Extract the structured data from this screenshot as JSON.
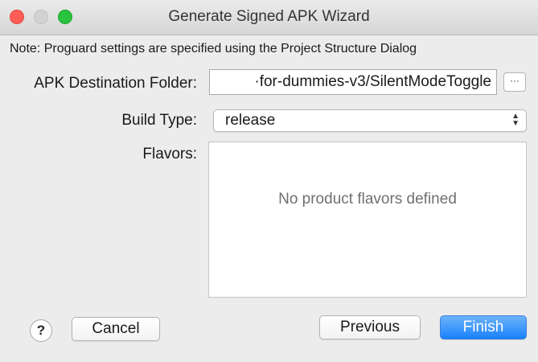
{
  "window": {
    "title": "Generate Signed APK Wizard"
  },
  "note": "Note: Proguard settings are specified using the Project Structure Dialog",
  "fields": {
    "apk_destination": {
      "label": "APK Destination Folder:",
      "value": "·for-dummies-v3/SilentModeToggle",
      "browse_label": "···"
    },
    "build_type": {
      "label": "Build Type:",
      "value": "release"
    },
    "flavors": {
      "label": "Flavors:",
      "empty_text": "No product flavors defined"
    }
  },
  "buttons": {
    "help": "?",
    "cancel": "Cancel",
    "previous": "Previous",
    "finish": "Finish"
  },
  "colors": {
    "close": "#fd5f57",
    "minimize": "#d2d2d2",
    "zoom": "#29c33f",
    "accent": "#1a82fb"
  }
}
